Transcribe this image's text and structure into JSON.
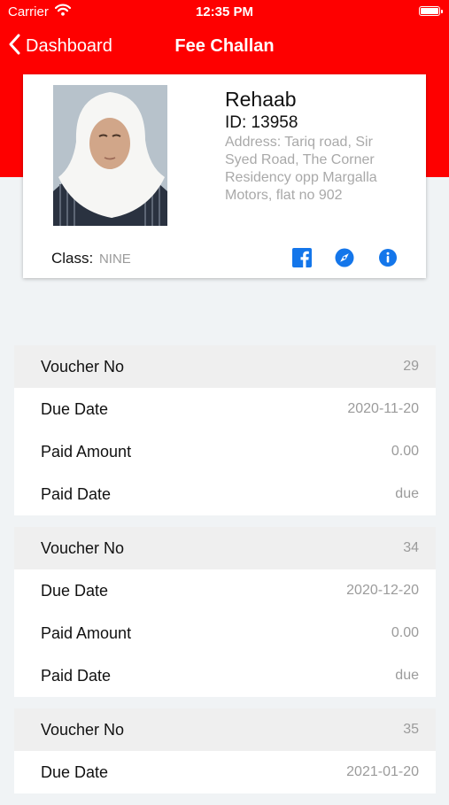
{
  "status": {
    "carrier": "Carrier",
    "time": "12:35 PM"
  },
  "nav": {
    "back_label": "Dashboard",
    "title": "Fee Challan"
  },
  "student": {
    "name": "Rehaab",
    "id_line": "ID: 13958",
    "address": "Address: Tariq road, Sir Syed Road, The Corner Residency opp Margalla Motors, flat no 902",
    "class_label": "Class:",
    "class_value": "NINE"
  },
  "icons": {
    "facebook": "facebook-icon",
    "compass": "compass-icon",
    "info": "info-icon"
  },
  "colors": {
    "header": "#fe0000",
    "icon_blue": "#1476ea"
  },
  "vouchers": [
    {
      "rows": [
        {
          "label": "Voucher No",
          "value": "29"
        },
        {
          "label": "Due Date",
          "value": "2020-11-20"
        },
        {
          "label": "Paid Amount",
          "value": "0.00"
        },
        {
          "label": "Paid Date",
          "value": "due"
        }
      ]
    },
    {
      "rows": [
        {
          "label": "Voucher No",
          "value": "34"
        },
        {
          "label": "Due Date",
          "value": "2020-12-20"
        },
        {
          "label": "Paid Amount",
          "value": "0.00"
        },
        {
          "label": "Paid Date",
          "value": "due"
        }
      ]
    },
    {
      "rows": [
        {
          "label": "Voucher No",
          "value": "35"
        },
        {
          "label": "Due Date",
          "value": "2021-01-20"
        }
      ]
    }
  ]
}
